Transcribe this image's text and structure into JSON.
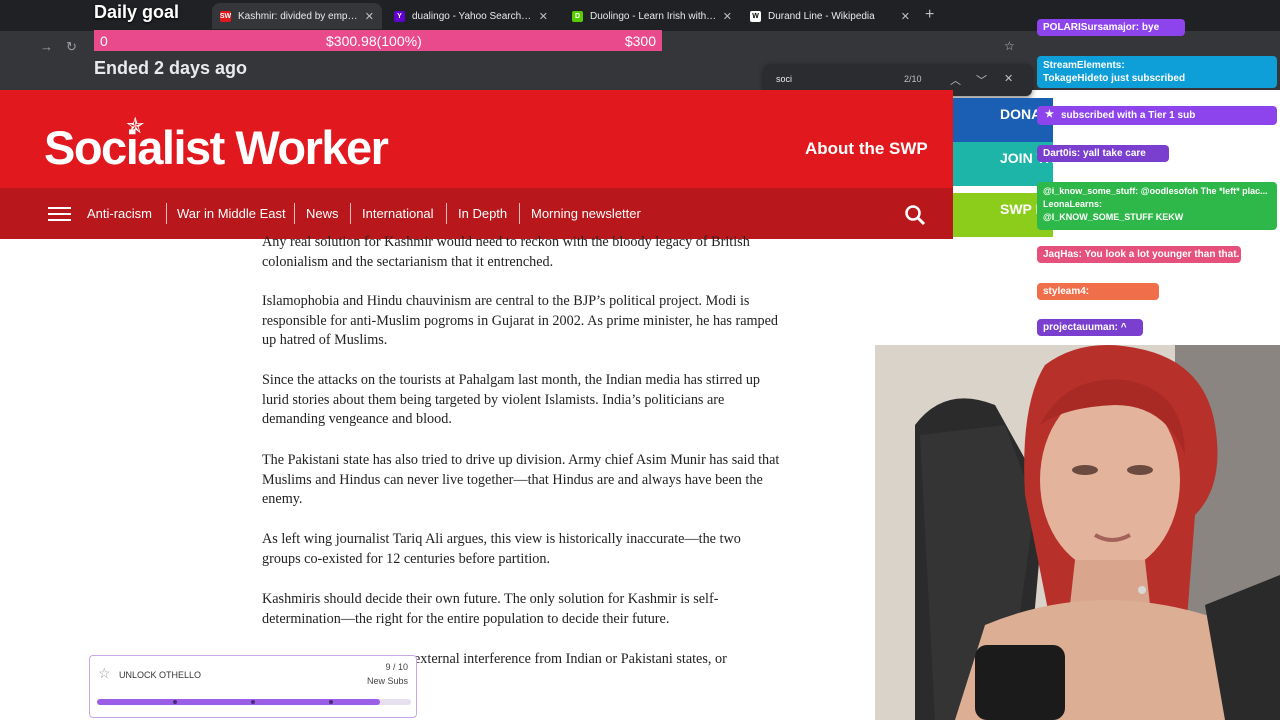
{
  "browser": {
    "tabs": [
      {
        "title": "Kashmir: divided by empire - So",
        "favicon": "SW",
        "favicon_color": "#e1191e",
        "active": true
      },
      {
        "title": "dualingo - Yahoo Search Results",
        "favicon": "Y",
        "favicon_color": "#6001d2",
        "active": false
      },
      {
        "title": "Duolingo - Learn Irish with less",
        "favicon": "D",
        "favicon_color": "#58cc02",
        "active": false
      },
      {
        "title": "Durand Line - Wikipedia",
        "favicon": "W",
        "favicon_color": "#ffffff",
        "active": false
      }
    ],
    "find": {
      "query": "soci",
      "count": "2/10"
    }
  },
  "goal_overlay": {
    "title": "Daily goal",
    "start": "0",
    "progress_text": "$300.98(100%)",
    "target": "$300",
    "status": "Ended 2 days ago"
  },
  "site": {
    "logo": "Socialist Worker",
    "about": "About the SWP",
    "side_buttons": [
      {
        "label": "DONATE",
        "color": "#1a5fb4"
      },
      {
        "label": "JOIN THE SWP",
        "color": "#1cb5a8"
      },
      {
        "label": "SWP MEMBERS",
        "color": "#8ccc1a"
      }
    ],
    "nav": [
      "Anti-racism",
      "War in Middle East",
      "News",
      "International",
      "In Depth",
      "Morning newsletter"
    ]
  },
  "article": {
    "paragraphs": [
      "Any real solution for Kashmir would need to reckon with the bloody legacy of British colonialism and the sectarianism that it entrenched.",
      "Islamophobia and Hindu chauvinism are central to the BJP’s political project. Modi is responsible for anti-Muslim pogroms in Gujarat in 2002. As prime minister, he has ramped up hatred of Muslims.",
      "Since the attacks on the tourists at Pahalgam last month, the Indian media has stirred up lurid stories about them being targeted by violent Islamists. India’s politicians are demanding vengeance and blood.",
      "The Pakistani state has also tried to drive up division. Army chief Asim Munir has said that Muslims and Hindus can never live together—that Hindus are and always have been the enemy.",
      "As left wing journalist Tariq Ali argues, this view is historically inaccurate—the two groups co-existed for 12 centuries before partition.",
      "Kashmiris should decide their own future. The only solution for Kashmir is self-determination—the right for the entire population to decide their future.",
      "external interference from Indian or Pakistani states, or"
    ]
  },
  "chat": [
    {
      "user": "POLARISursamajor:",
      "text": "bye",
      "color": "#8e44ec"
    },
    {
      "user": "StreamElements:",
      "text": "TokageHideto just subscribed",
      "color": "#0e9fd8"
    },
    {
      "user": "",
      "text": "subscribed with a Tier 1 sub",
      "color": "#8e44ec"
    },
    {
      "user": "Dart0is:",
      "text": "yall take care",
      "color": "#7b3fd0"
    },
    {
      "user": "",
      "text": "@i_know_some_stuff: @oodlesofoh The *left* plac...",
      "color": "#2fb84a"
    },
    {
      "user": "LeonaLearns:",
      "text": "@I_KNOW_SOME_STUFF KEKW",
      "color": "#2fb84a"
    },
    {
      "user": "JaqHas:",
      "text": "You look a lot younger than that.",
      "color": "#e6507c"
    },
    {
      "user": "styleam4:",
      "text": "",
      "color": "#f06e4a"
    },
    {
      "user": "projectauuman:",
      "text": "^",
      "color": "#7b3fd0"
    }
  ],
  "sub_goal": {
    "label": "UNLOCK OTHELLO",
    "count": "9 / 10",
    "kind": "New Subs",
    "progress": 0.9
  }
}
